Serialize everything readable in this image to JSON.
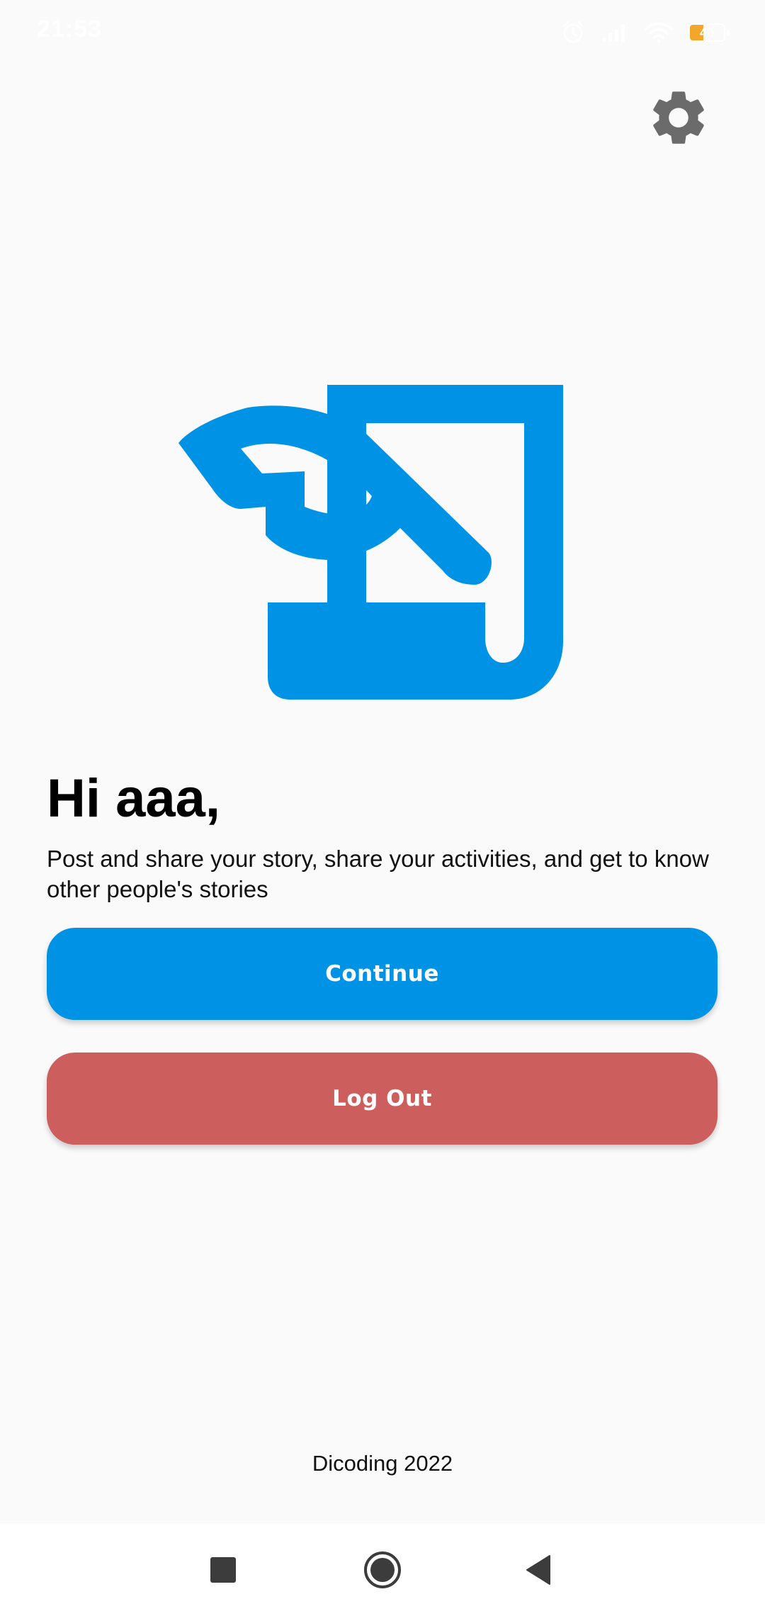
{
  "status_bar": {
    "time": "21:53",
    "battery_level": "40",
    "battery_fill_percent": 40,
    "battery_color": "#f4a62a",
    "icons": [
      "alarm-icon",
      "signal-icon",
      "wifi-icon",
      "battery-icon"
    ]
  },
  "header": {
    "settings_icon": "gear-icon"
  },
  "logo": {
    "icon": "story-app-logo",
    "color": "#0092e4"
  },
  "main": {
    "greeting": "Hi aaa,",
    "description": "Post and share your story, share your activities, and get to know other people's stories",
    "continue_label": "Continue",
    "logout_label": "Log Out"
  },
  "footer": {
    "text": "Dicoding 2022"
  },
  "nav_bar": {
    "icons": [
      "recents-square-icon",
      "home-circle-icon",
      "back-triangle-icon"
    ]
  },
  "colors": {
    "background": "#fafafa",
    "primary": "#0092e4",
    "danger": "#cd5e5e",
    "settings_icon": "#6b6b6b",
    "nav_icons": "#3c3c3c"
  }
}
